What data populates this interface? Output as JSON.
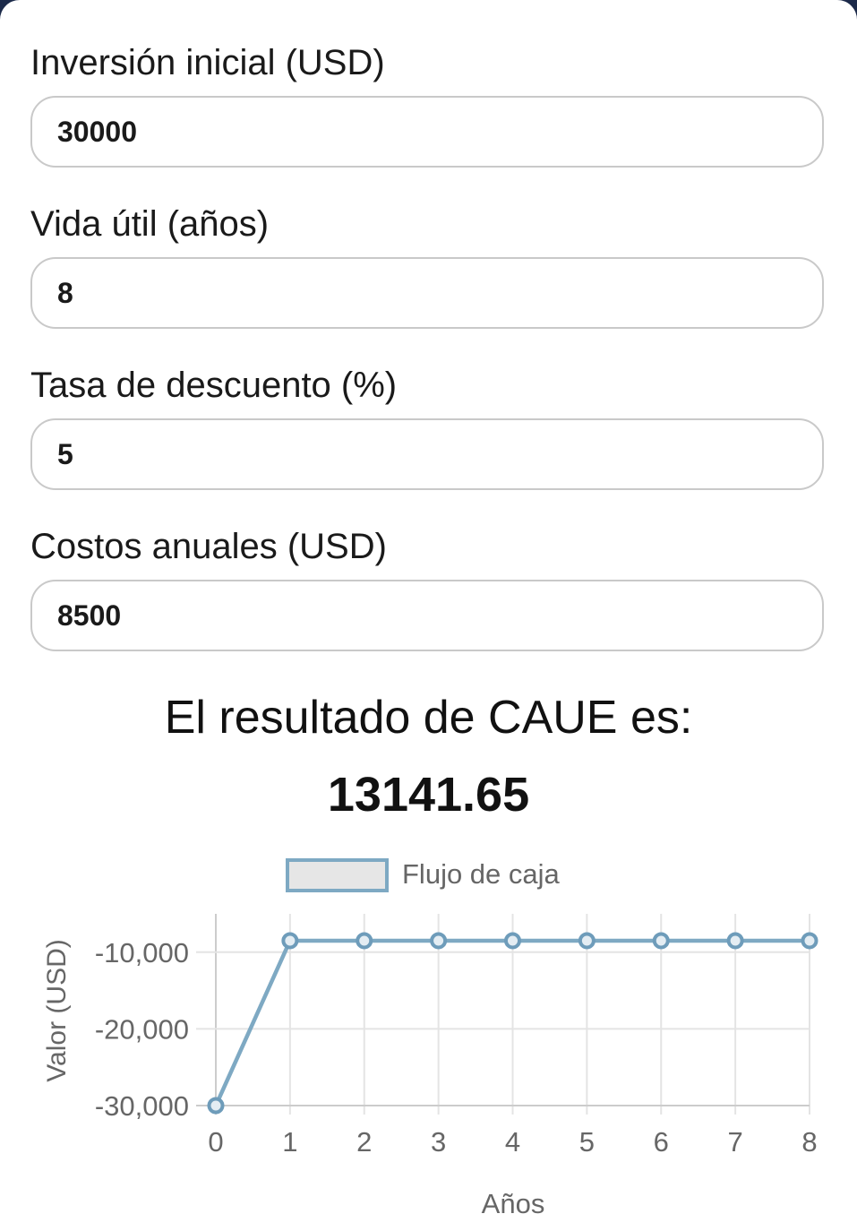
{
  "form": {
    "investment_label": "Inversión inicial (USD)",
    "investment_value": "30000",
    "life_label": "Vida útil (años)",
    "life_value": "8",
    "rate_label": "Tasa de descuento (%)",
    "rate_value": "5",
    "costs_label": "Costos anuales (USD)",
    "costs_value": "8500"
  },
  "result": {
    "heading": "El resultado de CAUE es:",
    "value": "13141.65"
  },
  "chart_data": {
    "type": "line",
    "title": "",
    "xlabel": "Años",
    "ylabel": "Valor (USD)",
    "categories": [
      "0",
      "1",
      "2",
      "3",
      "4",
      "5",
      "6",
      "7",
      "8"
    ],
    "series": [
      {
        "name": "Flujo de caja",
        "values": [
          -30000,
          -8500,
          -8500,
          -8500,
          -8500,
          -8500,
          -8500,
          -8500,
          -8500
        ]
      }
    ],
    "y_ticks": [
      -10000,
      -20000,
      -30000
    ],
    "y_tick_labels": [
      "-10,000",
      "-20,000",
      "-30,000"
    ],
    "ylim": [
      -30000,
      -5000
    ],
    "grid": true,
    "legend": "top",
    "colors": {
      "line": "#7ea9c3",
      "point_border": "#6e9cba",
      "legend_fill": "#e6e6e6",
      "grid": "#e4e4e4",
      "text": "#666666"
    }
  }
}
